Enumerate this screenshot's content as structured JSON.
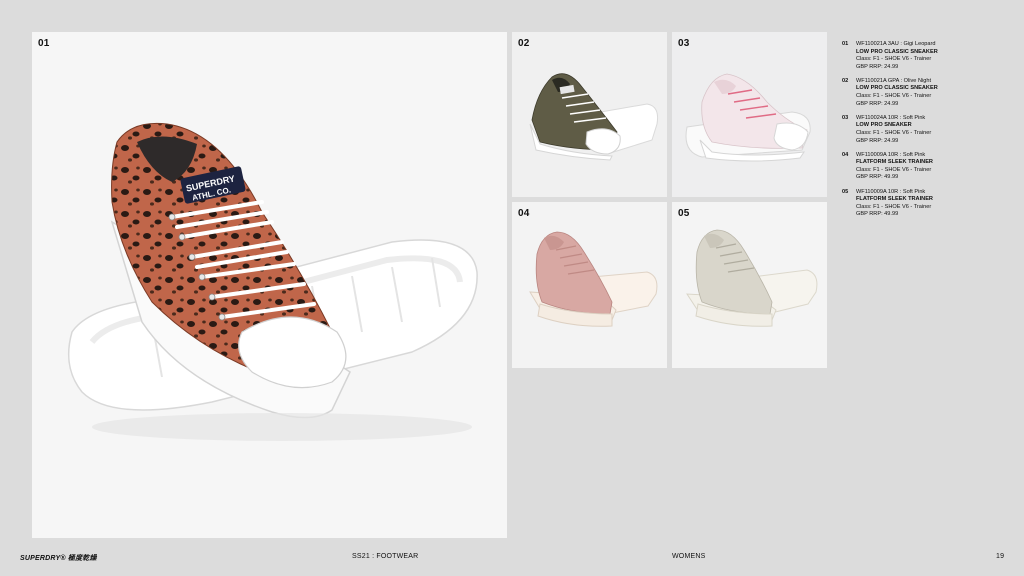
{
  "panels": [
    {
      "num": "01"
    },
    {
      "num": "02"
    },
    {
      "num": "03"
    },
    {
      "num": "04"
    },
    {
      "num": "05"
    }
  ],
  "products": [
    {
      "num": "01",
      "code": "WF110021A 3AU : Gigi Leopard",
      "name": "LOW PRO CLASSIC SNEAKER",
      "class": "Class: F1 - SHOE  V6 - Trainer",
      "price": "GBP RRP: 24.99"
    },
    {
      "num": "02",
      "code": "WF110021A GPA : Olive Night",
      "name": "LOW PRO CLASSIC SNEAKER",
      "class": "Class: F1 - SHOE  V6 - Trainer",
      "price": "GBP RRP: 24.99"
    },
    {
      "num": "03",
      "code": "WF110024A 10R : Soft Pink",
      "name": "LOW PRO SNEAKER",
      "class": "Class: F1 - SHOE  V6 - Trainer",
      "price": "GBP RRP: 24.99"
    },
    {
      "num": "04",
      "code": "WF110009A 10R : Soft Pink",
      "name": "FLATFORM SLEEK TRAINER",
      "class": "Class: F1 - SHOE  V6 - Trainer",
      "price": "GBP RRP: 49.99"
    },
    {
      "num": "05",
      "code": "WF110009A 10R : Soft Pink",
      "name": "FLATFORM SLEEK TRAINER",
      "class": "Class: F1 - SHOE  V6 - Trainer",
      "price": "GBP RRP: 49.99"
    }
  ],
  "hero_tongue_label": {
    "line1": "SUPERDRY",
    "line2": "ATHL. CO."
  },
  "footer": {
    "brand": "SUPERDRY® 極度乾燥",
    "section": "SS21 : FOOTWEAR",
    "category": "WOMENS",
    "page": "19"
  },
  "colors": {
    "background": "#dcdcdc",
    "leopard": "#b9603f",
    "olive": "#5c5a44",
    "soft_pink": "#eedcdf",
    "dusty_pink": "#d8a7a2",
    "stone": "#d9d6cb"
  }
}
